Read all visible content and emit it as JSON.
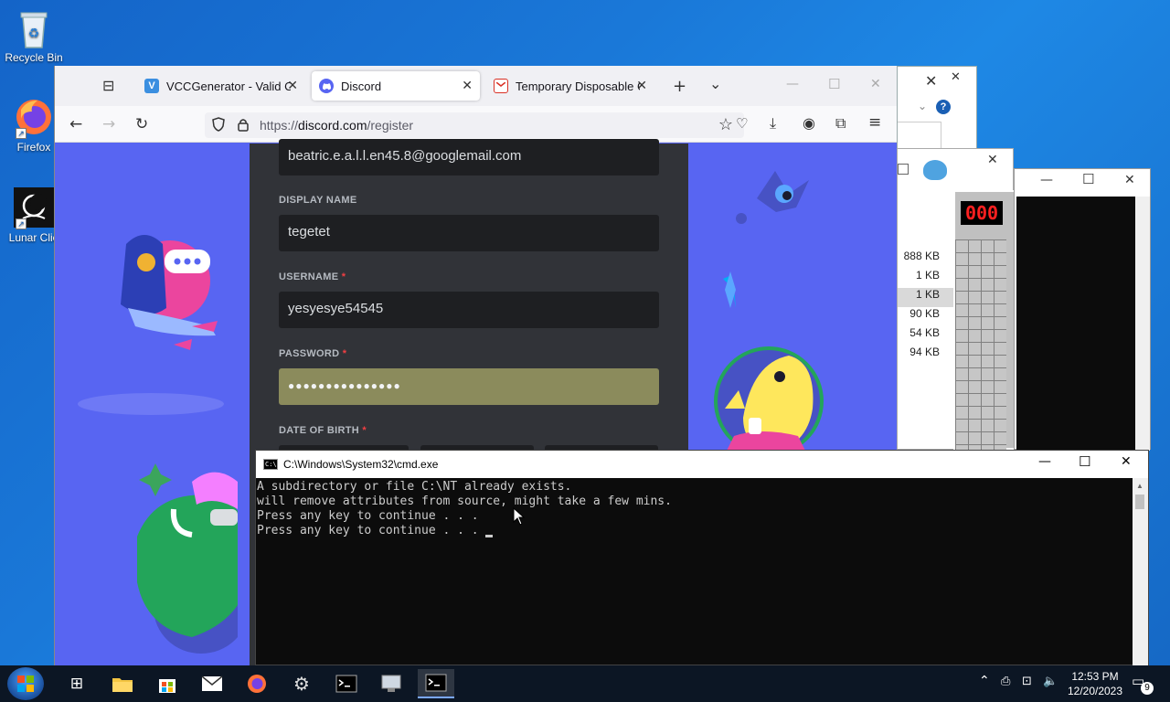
{
  "desktop": {
    "icons": [
      {
        "label": "Recycle Bin"
      },
      {
        "label": "Firefox"
      },
      {
        "label": "Lunar Clie"
      }
    ]
  },
  "firefox": {
    "tabs": [
      {
        "label": "VCCGenerator - Valid Cre",
        "favicon_letter": "V"
      },
      {
        "label": "Discord"
      },
      {
        "label": "Temporary Disposable Gm"
      }
    ],
    "url_prefix": "https://",
    "url_domain": "discord.com",
    "url_path": "/register"
  },
  "register_form": {
    "email_value": "beatric.e.a.l.l.en45.8@googlemail.com",
    "display_name_label": "DISPLAY NAME",
    "display_name_value": "tegetet",
    "username_label": "USERNAME",
    "username_value": "yesyesye54545",
    "password_label": "PASSWORD",
    "password_value": "●●●●●●●●●●●●●●●",
    "dob_label": "DATE OF BIRTH",
    "required_mark": "*"
  },
  "background_window": {
    "file_sizes": [
      "888 KB",
      "1 KB",
      "1 KB",
      "90 KB",
      "54 KB",
      "94 KB"
    ],
    "help_icon": "?",
    "minesweeper_counter": "000"
  },
  "cmd": {
    "title": "C:\\Windows\\System32\\cmd.exe",
    "lines": [
      "A subdirectory or file C:\\NT already exists.",
      "will remove attributes from source, might take a few mins.",
      "Press any key to continue . . .",
      "Press any key to continue . . . "
    ]
  },
  "taskbar": {
    "time": "12:53 PM",
    "date": "12/20/2023",
    "notification_count": "9"
  },
  "colors": {
    "discord_blurple": "#5865f2",
    "discord_card": "#313338",
    "discord_input": "#1e1f22",
    "required_red": "#f23f43",
    "taskbar": "#0c1624"
  }
}
